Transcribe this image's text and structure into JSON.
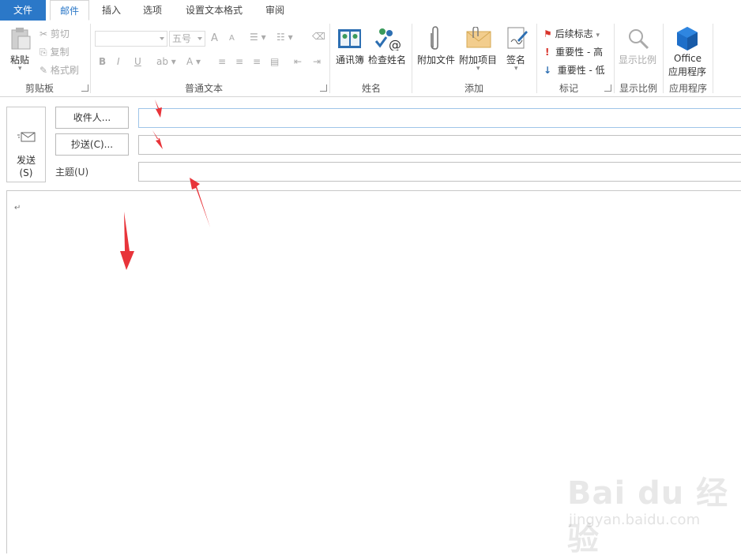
{
  "tabs": {
    "file": "文件",
    "mail": "邮件",
    "insert": "插入",
    "options": "选项",
    "format": "设置文本格式",
    "review": "审阅"
  },
  "clipboard": {
    "paste": "粘贴",
    "cut": "剪切",
    "copy": "复制",
    "format_painter": "格式刷",
    "label": "剪贴板"
  },
  "basic_text": {
    "font_size": "五号",
    "bold": "B",
    "italic": "I",
    "underline": "U",
    "font_color": "A",
    "grow": "A",
    "shrink": "A",
    "label": "普通文本"
  },
  "names": {
    "address_book": "通讯簿",
    "check_names": "检查姓名",
    "label": "姓名"
  },
  "include": {
    "attach_file": "附加文件",
    "attach_item": "附加项目",
    "signature": "签名",
    "label": "添加"
  },
  "tags": {
    "follow_up": "后续标志",
    "high_importance": "重要性 - 高",
    "low_importance": "重要性 - 低",
    "label": "标记"
  },
  "zoom": {
    "zoom": "显示比例",
    "label": "显示比例"
  },
  "apps": {
    "office": "Office",
    "office2": "应用程序",
    "label": "应用程序"
  },
  "compose": {
    "send": "发送",
    "send_key": "(S)",
    "to": "收件人...",
    "cc": "抄送(C)...",
    "subject": "主题(U)",
    "paragraph_mark": "↵"
  },
  "watermark": {
    "logo": "Bai du 经验",
    "url": "jingyan.baidu.com"
  },
  "colors": {
    "accent": "#2b78c8",
    "arrow": "#e8343a"
  }
}
